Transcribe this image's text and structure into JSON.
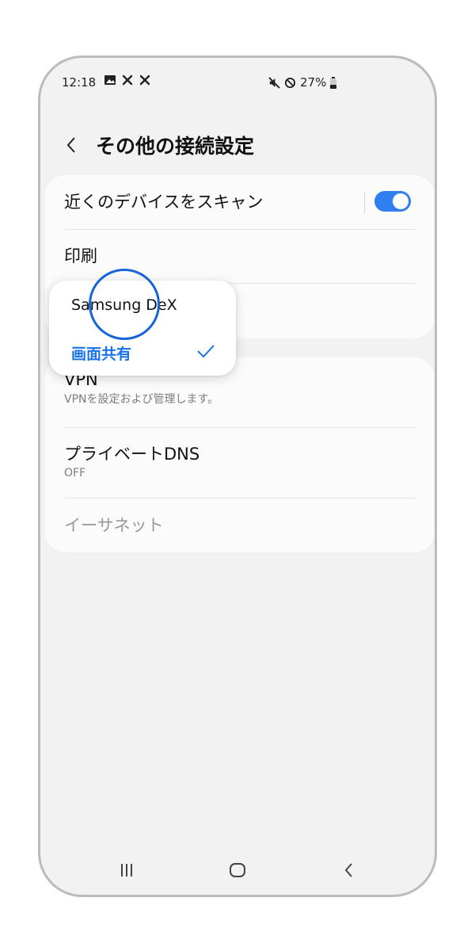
{
  "status_bar": {
    "time": "12:18",
    "left_icons": [
      "gallery-icon",
      "tools-icon",
      "tools-icon"
    ],
    "right_icons": [
      "mute-icon",
      "dnd-icon"
    ],
    "battery": "27%"
  },
  "header": {
    "back_icon": "chevron-left-icon",
    "title": "その他の接続設定"
  },
  "settings_group1": {
    "nearby_scan": {
      "label": "近くのデバイスをスキャン",
      "enabled": true
    },
    "print": {
      "label": "印刷"
    }
  },
  "popup": {
    "options": [
      {
        "label": "Samsung DeX",
        "selected": false
      },
      {
        "label": "画面共有",
        "selected": true
      }
    ]
  },
  "settings_group2": {
    "vpn": {
      "label": "VPN",
      "sub": "VPNを設定および管理します。"
    },
    "private_dns": {
      "label": "プライベートDNS",
      "sub": "OFF"
    },
    "ethernet": {
      "label": "イーサネット",
      "disabled": true
    }
  },
  "nav_bar": {
    "buttons": [
      "recents-icon",
      "home-icon",
      "back-icon"
    ]
  },
  "colors": {
    "accent": "#2f7ff0",
    "popup_selected": "#1a73e8",
    "background": "#f2f2f2",
    "card": "#fbfbfb"
  }
}
